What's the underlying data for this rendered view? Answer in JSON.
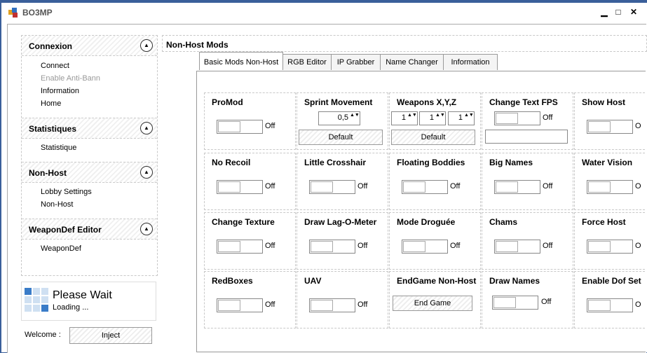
{
  "window": {
    "title": "BO3MP",
    "min": "▁",
    "max": "□",
    "close": "✕"
  },
  "sidebar": {
    "sections": [
      {
        "title": "Connexion",
        "items": [
          {
            "label": "Connect",
            "dim": false
          },
          {
            "label": "Enable Anti-Bann",
            "dim": true
          },
          {
            "label": "Information",
            "dim": false
          },
          {
            "label": "Home",
            "dim": false
          }
        ]
      },
      {
        "title": "Statistiques",
        "items": [
          {
            "label": "Statistique",
            "dim": false
          }
        ]
      },
      {
        "title": "Non-Host",
        "items": [
          {
            "label": "Lobby Settings",
            "dim": false
          },
          {
            "label": "Non-Host",
            "dim": false
          }
        ]
      },
      {
        "title": "WeaponDef Editor",
        "items": [
          {
            "label": "WeaponDef",
            "dim": false
          }
        ]
      }
    ],
    "collapse_glyph": "▲",
    "wait": {
      "title": "Please Wait",
      "sub": "Loading ..."
    },
    "welcome_label": "Welcome :",
    "inject_label": "Inject"
  },
  "main": {
    "title": "Non-Host Mods",
    "tabs": [
      "Basic Mods Non-Host",
      "RGB Editor",
      "IP Grabber",
      "Name Changer",
      "Information"
    ],
    "off_label": "Off",
    "spin_arrows": "▲▼",
    "cells": {
      "promod": "ProMod",
      "sprint": "Sprint Movement",
      "sprint_value": "0,5",
      "weapons": "Weapons X,Y,Z",
      "weapons_values": [
        "1",
        "1",
        "1"
      ],
      "fps": "Change Text FPS",
      "showhost": "Show Host",
      "default_label": "Default",
      "norecoil": "No Recoil",
      "crosshair": "Little Crosshair",
      "floating": "Floating Boddies",
      "bignames": "Big Names",
      "water": "Water Vision",
      "texture": "Change Texture",
      "lag": "Draw Lag-O-Meter",
      "droguee": "Mode Droguée",
      "chams": "Chams",
      "forcehost": "Force Host",
      "redboxes": "RedBoxes",
      "uav": "UAV",
      "endgame": "EndGame Non-Host",
      "endgame_button": "End Game",
      "drawnames": "Draw Names",
      "dof": "Enable Dof Set",
      "clipped_off": "O"
    }
  }
}
